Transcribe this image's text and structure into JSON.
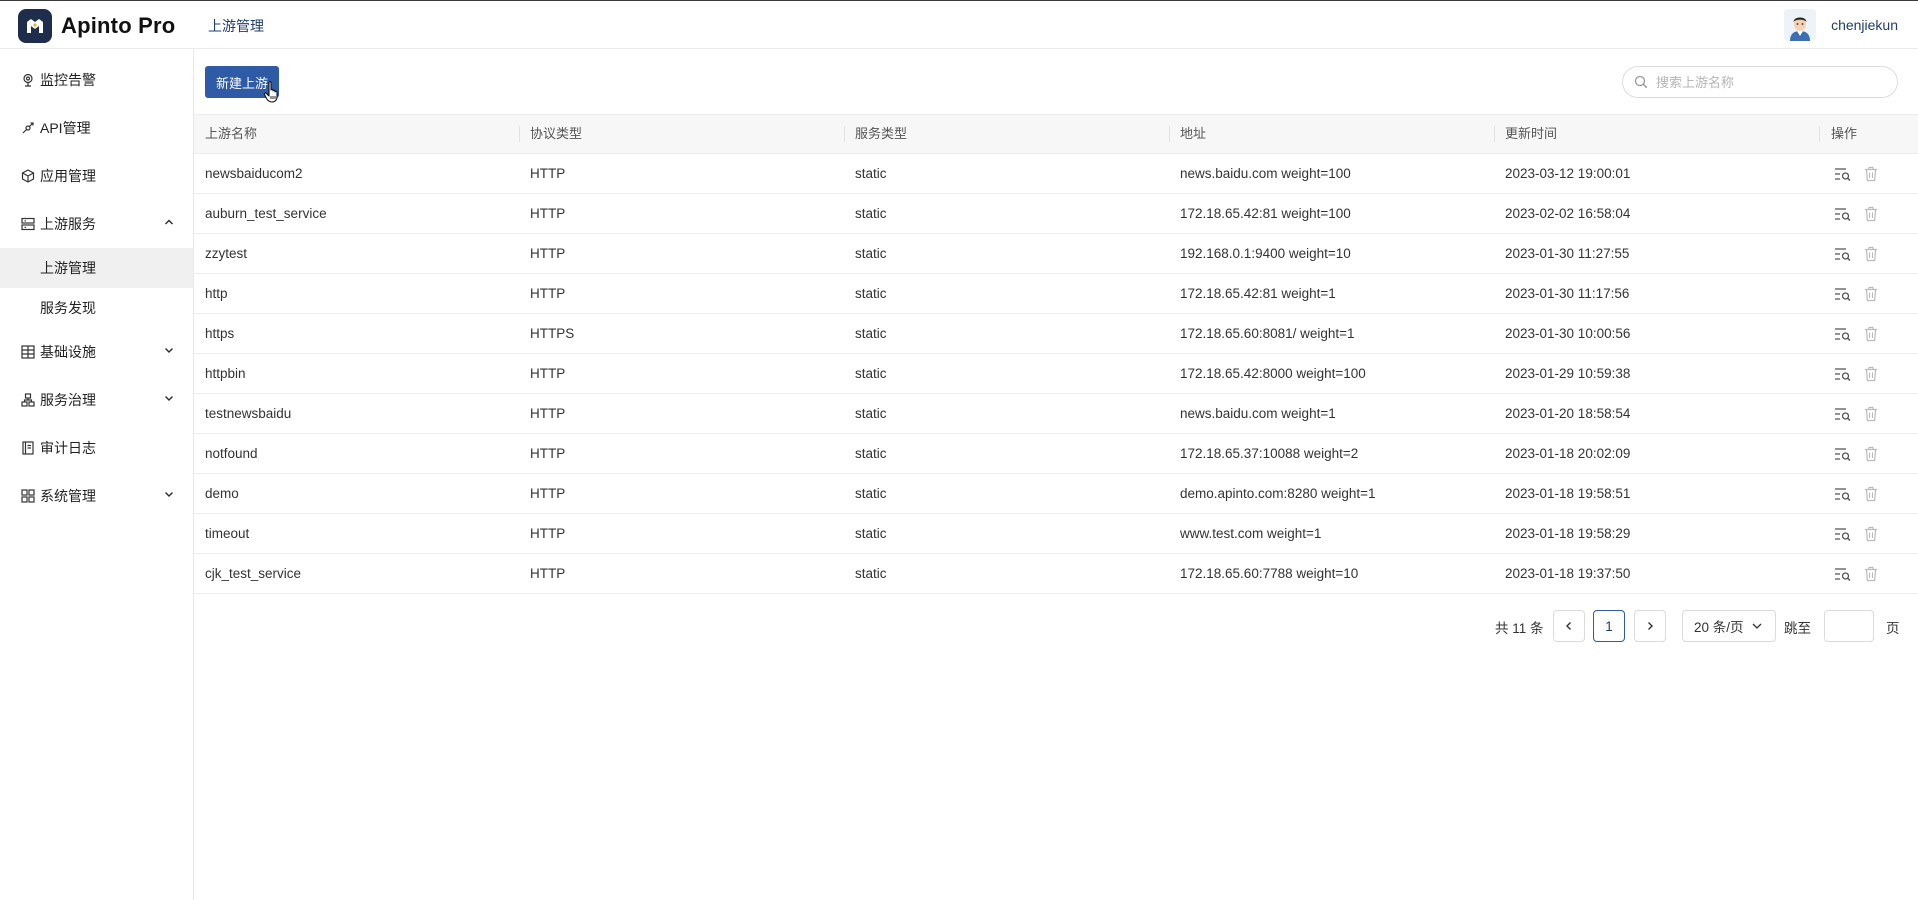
{
  "app": {
    "name": "Apinto Pro"
  },
  "header": {
    "breadcrumb": "上游管理",
    "user_name": "chenjiekun"
  },
  "sidebar": {
    "items": [
      {
        "label": "监控告警",
        "icon": "monitor-icon"
      },
      {
        "label": "API管理",
        "icon": "api-icon"
      },
      {
        "label": "应用管理",
        "icon": "app-icon"
      },
      {
        "label": "上游服务",
        "icon": "upstream-icon",
        "expanded": true,
        "children": [
          {
            "label": "上游管理",
            "active": true
          },
          {
            "label": "服务发现"
          }
        ]
      },
      {
        "label": "基础设施",
        "icon": "infrastructure-icon",
        "expanded": false
      },
      {
        "label": "服务治理",
        "icon": "governance-icon",
        "expanded": false
      },
      {
        "label": "审计日志",
        "icon": "audit-log-icon"
      },
      {
        "label": "系统管理",
        "icon": "system-icon",
        "expanded": false
      }
    ]
  },
  "toolbar": {
    "new_button": "新建上游",
    "search_placeholder": "搜索上游名称"
  },
  "table": {
    "columns": [
      "上游名称",
      "协议类型",
      "服务类型",
      "地址",
      "更新时间",
      "操作"
    ],
    "rows": [
      {
        "name": "newsbaiducom2",
        "protocol": "HTTP",
        "service_type": "static",
        "address": "news.baidu.com weight=100",
        "updated": "2023-03-12 19:00:01"
      },
      {
        "name": "auburn_test_service",
        "protocol": "HTTP",
        "service_type": "static",
        "address": "172.18.65.42:81 weight=100",
        "updated": "2023-02-02 16:58:04"
      },
      {
        "name": "zzytest",
        "protocol": "HTTP",
        "service_type": "static",
        "address": "192.168.0.1:9400 weight=10",
        "updated": "2023-01-30 11:27:55"
      },
      {
        "name": "http",
        "protocol": "HTTP",
        "service_type": "static",
        "address": "172.18.65.42:81 weight=1",
        "updated": "2023-01-30 11:17:56"
      },
      {
        "name": "https",
        "protocol": "HTTPS",
        "service_type": "static",
        "address": "172.18.65.60:8081/ weight=1",
        "updated": "2023-01-30 10:00:56"
      },
      {
        "name": "httpbin",
        "protocol": "HTTP",
        "service_type": "static",
        "address": "172.18.65.42:8000 weight=100",
        "updated": "2023-01-29 10:59:38"
      },
      {
        "name": "testnewsbaidu",
        "protocol": "HTTP",
        "service_type": "static",
        "address": "news.baidu.com weight=1",
        "updated": "2023-01-20 18:58:54"
      },
      {
        "name": "notfound",
        "protocol": "HTTP",
        "service_type": "static",
        "address": "172.18.65.37:10088 weight=2",
        "updated": "2023-01-18 20:02:09"
      },
      {
        "name": "demo",
        "protocol": "HTTP",
        "service_type": "static",
        "address": "demo.apinto.com:8280 weight=1",
        "updated": "2023-01-18 19:58:51"
      },
      {
        "name": "timeout",
        "protocol": "HTTP",
        "service_type": "static",
        "address": "www.test.com weight=1",
        "updated": "2023-01-18 19:58:29"
      },
      {
        "name": "cjk_test_service",
        "protocol": "HTTP",
        "service_type": "static",
        "address": "172.18.65.60:7788 weight=10",
        "updated": "2023-01-18 19:37:50"
      }
    ]
  },
  "pagination": {
    "total_label": "共 11 条",
    "current_page": "1",
    "page_size_label": "20 条/页",
    "jump_label": "跳至",
    "jump_value": "",
    "page_suffix": "页"
  },
  "colors": {
    "primary": "#2e5aa6",
    "brand_dark": "#1f2d4d",
    "link": "#1f3d6b"
  }
}
